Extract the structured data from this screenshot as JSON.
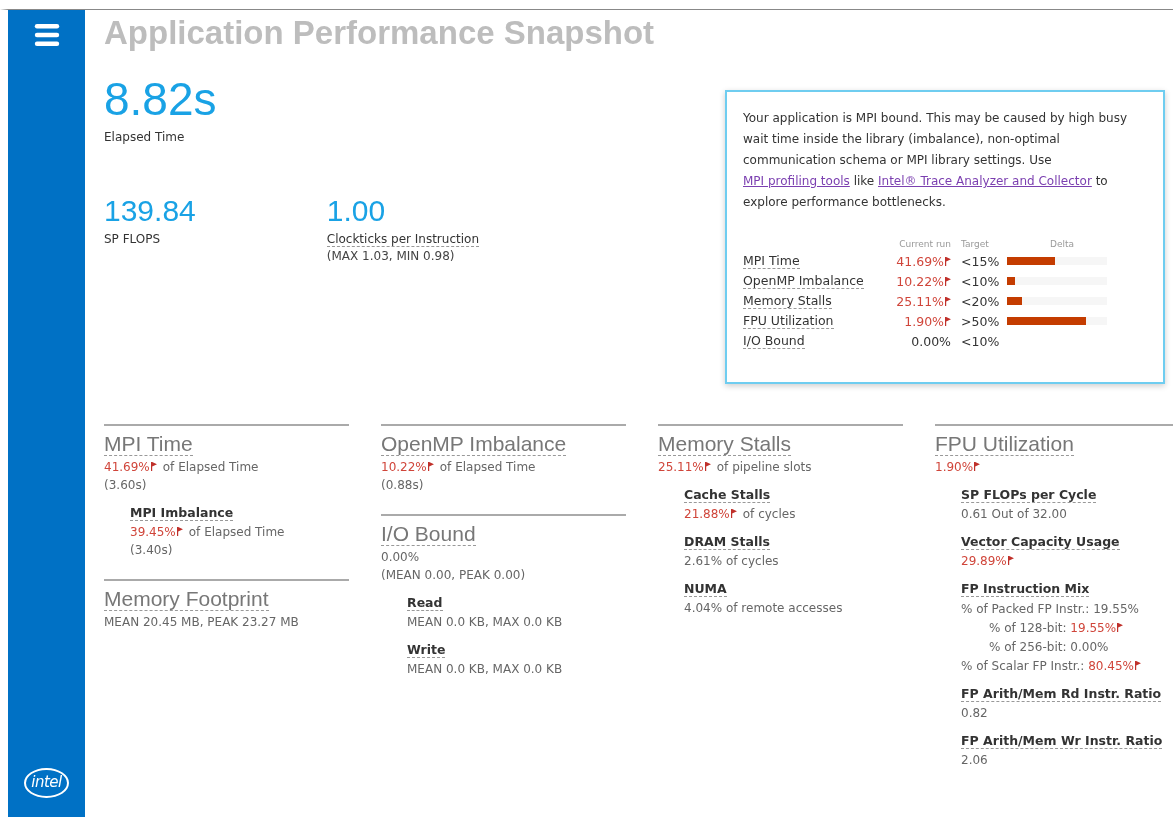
{
  "title": "Application Performance Snapshot",
  "logo": "intel",
  "elapsed": {
    "value": "8.82s",
    "label": "Elapsed Time"
  },
  "metrics": [
    {
      "value": "139.84",
      "label": "SP FLOPS"
    },
    {
      "value": "1.00",
      "label": "Clockticks per Instruction",
      "note": "(MAX 1.03, MIN 0.98)"
    }
  ],
  "summary": {
    "text": [
      {
        "kind": "text",
        "text": "Your application is MPI bound. This may be caused by high busy wait time inside the library (imbalance), non-optimal communication schema or MPI library settings. Use "
      },
      {
        "kind": "link",
        "text": "MPI profiling tools"
      },
      {
        "kind": "text",
        "text": " like "
      },
      {
        "kind": "link",
        "text": "Intel® Trace Analyzer and Collector"
      },
      {
        "kind": "text",
        "text": " to explore performance bottlenecks."
      }
    ],
    "columns": [
      "Current run",
      "Target",
      "Delta"
    ],
    "rows": [
      {
        "name": "MPI Time",
        "current": "41.69%",
        "flagged": true,
        "target": "<15%",
        "level": 0.48
      },
      {
        "name": "OpenMP Imbalance",
        "current": "10.22%",
        "flagged": true,
        "target": "<10%",
        "level": 0.08
      },
      {
        "name": "Memory Stalls",
        "current": "25.11%",
        "flagged": true,
        "target": "<20%",
        "level": 0.15
      },
      {
        "name": "FPU Utilization",
        "current": "1.90%",
        "flagged": true,
        "target": ">50%",
        "level": 0.79
      },
      {
        "name": "I/O Bound",
        "current": "0.00%",
        "flagged": false,
        "target": "<10%"
      }
    ]
  },
  "columns": [
    [
      {
        "title": "MPI Time",
        "value": "41.69%",
        "flagged": true,
        "suffix": "of Elapsed Time",
        "lines": [
          "(3.60s)"
        ],
        "subs": [
          {
            "title": "MPI Imbalance",
            "value": "39.45%",
            "flagged": true,
            "suffix": "of Elapsed Time",
            "lines": [
              "(3.40s)"
            ]
          }
        ]
      },
      {
        "title": "Memory Footprint",
        "lines": [
          "MEAN 20.45 MB, PEAK 23.27 MB"
        ]
      }
    ],
    [
      {
        "title": "OpenMP Imbalance",
        "value": "10.22%",
        "flagged": true,
        "suffix": "of Elapsed Time",
        "lines": [
          "(0.88s)"
        ]
      },
      {
        "title": "I/O Bound",
        "value": "0.00%",
        "flagged": false,
        "lines": [
          "(MEAN 0.00, PEAK 0.00)"
        ],
        "subs": [
          {
            "title": "Read",
            "lines": [
              "MEAN 0.0 KB, MAX 0.0 KB"
            ]
          },
          {
            "title": "Write",
            "lines": [
              "MEAN 0.0 KB, MAX 0.0 KB"
            ]
          }
        ]
      }
    ],
    [
      {
        "title": "Memory Stalls",
        "value": "25.11%",
        "flagged": true,
        "suffix": "of pipeline slots",
        "subs": [
          {
            "title": "Cache Stalls",
            "value": "21.88%",
            "flagged": true,
            "suffix": "of cycles"
          },
          {
            "title": "DRAM Stalls",
            "value": "2.61%",
            "flagged": false,
            "suffix": "of cycles"
          },
          {
            "title": "NUMA",
            "value": "4.04%",
            "flagged": false,
            "suffix": "of remote accesses"
          }
        ]
      }
    ],
    [
      {
        "title": "FPU Utilization",
        "value": "1.90%",
        "flagged": true,
        "subs": [
          {
            "title": "SP FLOPs per Cycle",
            "value": "0.61 Out of 32.00",
            "flagged": false
          },
          {
            "title": "Vector Capacity Usage",
            "value": "29.89%",
            "flagged": true
          },
          {
            "title": "FP Instruction Mix",
            "rows": [
              {
                "label": "% of Packed FP Instr.:",
                "value": "19.55%",
                "flagged": false,
                "nested": false
              },
              {
                "label": "% of 128-bit:",
                "value": "19.55%",
                "flagged": true,
                "nested": true
              },
              {
                "label": "% of 256-bit:",
                "value": "0.00%",
                "flagged": false,
                "nested": true
              },
              {
                "label": "% of Scalar FP Instr.:",
                "value": "80.45%",
                "flagged": true,
                "nested": false
              }
            ]
          },
          {
            "title": "FP Arith/Mem Rd Instr. Ratio",
            "value": "0.82",
            "flagged": false
          },
          {
            "title": "FP Arith/Mem Wr Instr. Ratio",
            "value": "2.06",
            "flagged": false
          }
        ]
      }
    ]
  ]
}
